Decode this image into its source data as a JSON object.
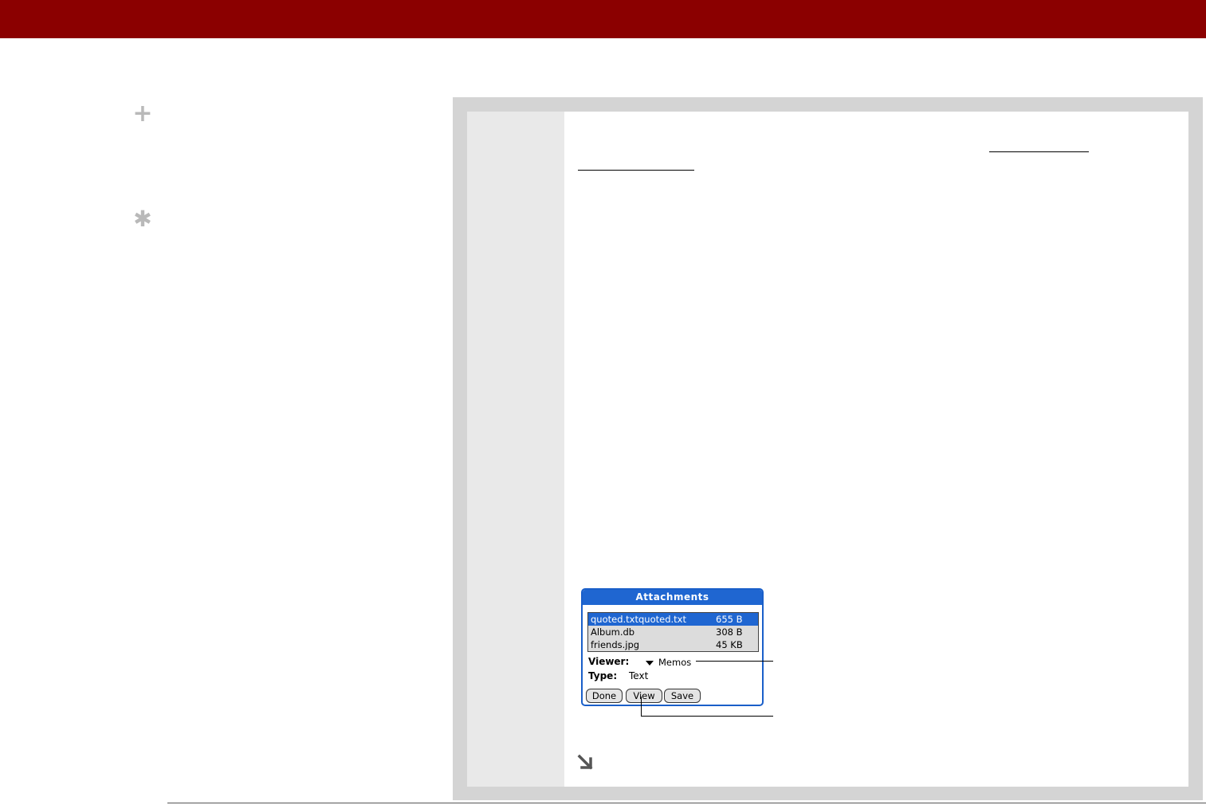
{
  "colors": {
    "header_bar": "#8b0000",
    "frame": "#d4d4d4",
    "step_column": "#e9e9e9",
    "dialog_blue": "#1f66d1",
    "sidebar_icon": "#b9b9b9"
  },
  "sidebar": {
    "icons": [
      "plus-icon",
      "asterisk-icon"
    ],
    "plus_glyph": "+",
    "star_glyph": "✱"
  },
  "dialog": {
    "title": "Attachments",
    "files": [
      {
        "name": "quoted.txtquoted.txt",
        "size": "655 B",
        "selected": true
      },
      {
        "name": "Album.db",
        "size": "308 B",
        "selected": false
      },
      {
        "name": "friends.jpg",
        "size": "45 KB",
        "selected": false
      }
    ],
    "viewer_label": "Viewer:",
    "viewer_value": "Memos",
    "type_label": "Type:",
    "type_value": "Text",
    "buttons": {
      "done": "Done",
      "view": "View",
      "save": "Save"
    }
  },
  "continue_icon": "arrow-down-right-icon"
}
